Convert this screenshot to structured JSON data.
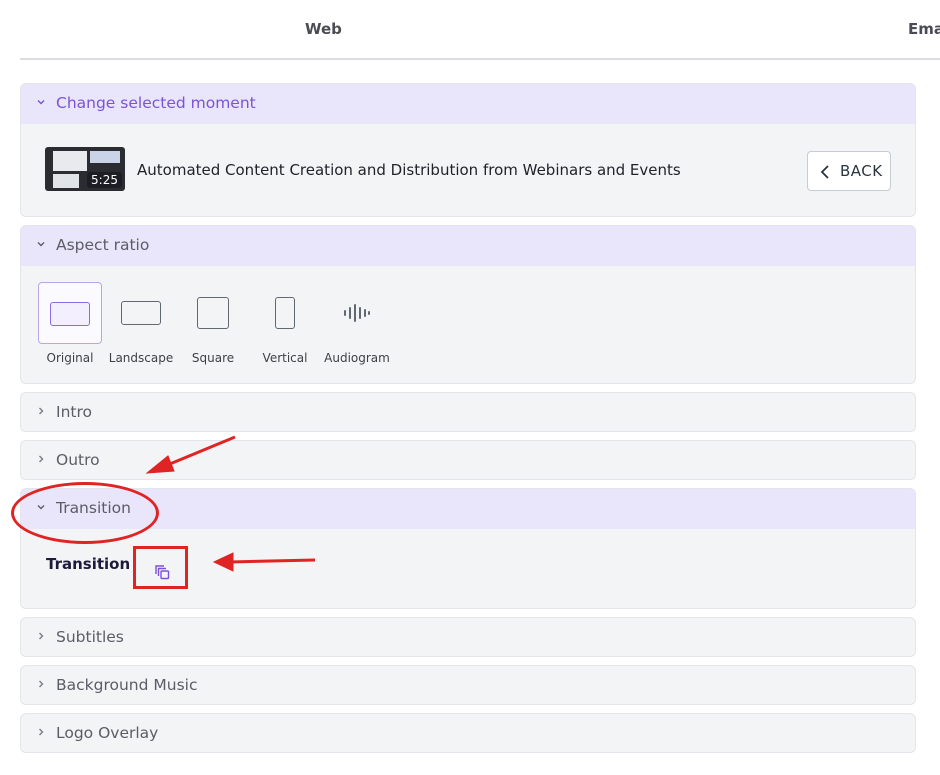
{
  "tabs": [
    {
      "label": "Web"
    },
    {
      "label": "Ema"
    }
  ],
  "moment_panel": {
    "title": "Change selected moment",
    "duration": "5:25",
    "moment_title": "Automated Content Creation and Distribution from Webinars and Events",
    "back_label": "BACK"
  },
  "aspect_panel": {
    "title": "Aspect ratio",
    "options": [
      {
        "label": "Original"
      },
      {
        "label": "Landscape"
      },
      {
        "label": "Square"
      },
      {
        "label": "Vertical"
      },
      {
        "label": "Audiogram"
      }
    ],
    "selected": "Original"
  },
  "sections": {
    "intro": "Intro",
    "outro": "Outro",
    "transition": "Transition",
    "subtitles": "Subtitles",
    "background_music": "Background Music",
    "logo_overlay": "Logo Overlay"
  },
  "transition_panel": {
    "field_label": "Transition"
  },
  "colors": {
    "accent": "#7c52d9",
    "annotation": "#e02424",
    "open_header": "#e9e5fb"
  },
  "icons": {
    "chevron": "chevron-icon",
    "back": "chevron-left-icon",
    "audiogram": "waveform-icon",
    "transition": "transition-copy-icon"
  }
}
